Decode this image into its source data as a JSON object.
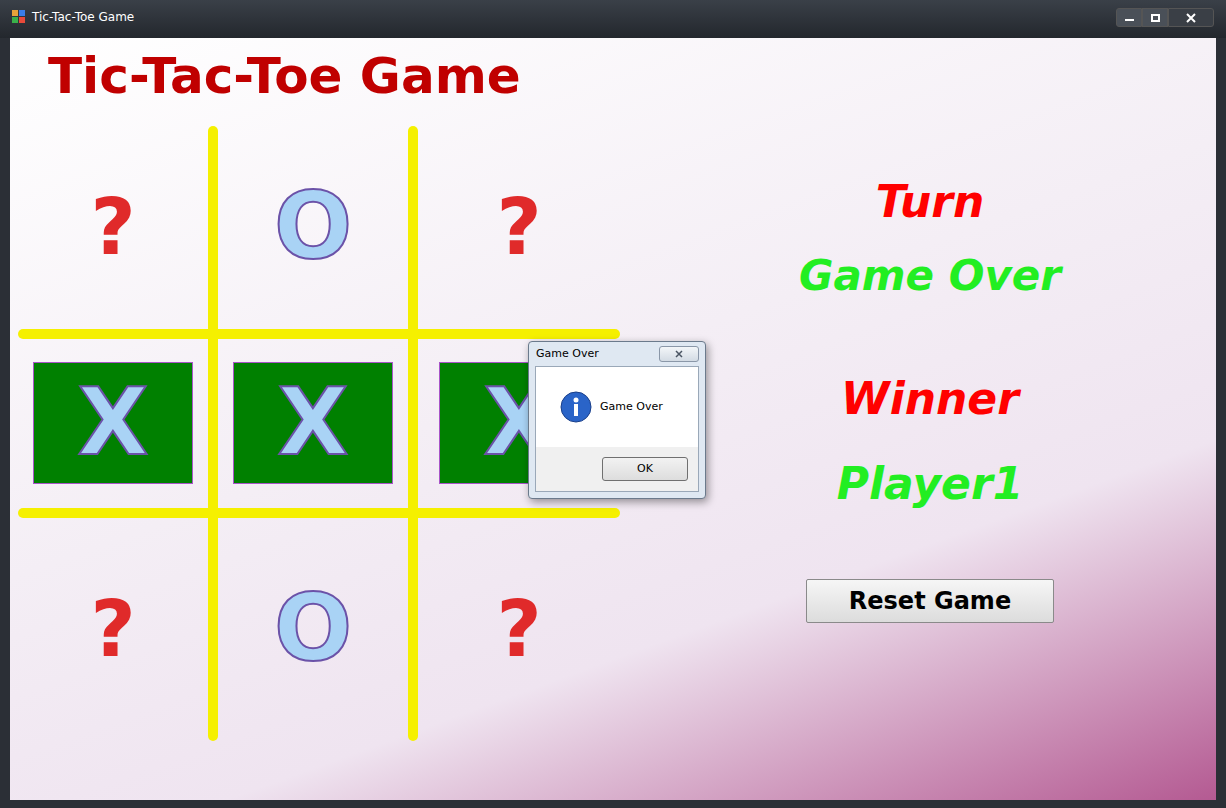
{
  "window": {
    "title": "Tic-Tac-Toe Game"
  },
  "heading": "Tic-Tac-Toe Game",
  "board": {
    "cells": [
      {
        "mark": "?",
        "kind": "empty",
        "winning": false
      },
      {
        "mark": "O",
        "kind": "o",
        "winning": false
      },
      {
        "mark": "?",
        "kind": "empty",
        "winning": false
      },
      {
        "mark": "X",
        "kind": "x",
        "winning": true
      },
      {
        "mark": "X",
        "kind": "x",
        "winning": true
      },
      {
        "mark": "X",
        "kind": "x",
        "winning": true
      },
      {
        "mark": "?",
        "kind": "empty",
        "winning": false
      },
      {
        "mark": "O",
        "kind": "o",
        "winning": false
      },
      {
        "mark": "?",
        "kind": "empty",
        "winning": false
      }
    ]
  },
  "status": {
    "turn_label": "Turn",
    "turn_value": "Game Over",
    "winner_label": "Winner",
    "winner_value": "Player1"
  },
  "reset_button": "Reset Game",
  "dialog": {
    "title": "Game Over",
    "message": "Game Over",
    "buttons": [
      "OK"
    ]
  }
}
